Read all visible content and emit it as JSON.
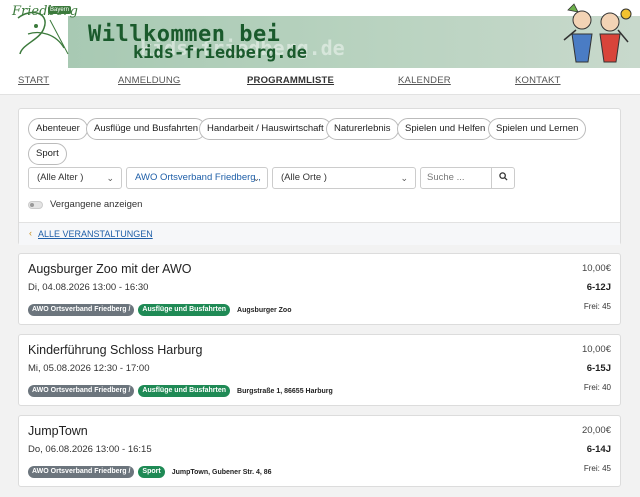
{
  "header": {
    "logo_text": "Friedberg",
    "logo_badge": "Bayern",
    "title_line1": "Willkommen bei",
    "title_line2": "kids-friedberg.de",
    "watermark": "kids-friedberg.de"
  },
  "nav": {
    "items": [
      {
        "label": "START"
      },
      {
        "label": "ANMELDUNG"
      },
      {
        "label": "PROGRAMMLISTE"
      },
      {
        "label": "KALENDER"
      },
      {
        "label": "KONTAKT"
      }
    ]
  },
  "filters": {
    "categories": [
      "Abenteuer",
      "Ausflüge und Busfahrten",
      "Handarbeit / Hauswirtschaft",
      "Naturerlebnis",
      "Spielen und Helfen",
      "Spielen und Lernen",
      "Sport"
    ],
    "age_select": "(Alle Alter )",
    "organizer_select": "AWO Ortsverband Friedberg ,",
    "location_select": "(Alle Orte )",
    "search_placeholder": "Suche ...",
    "search_icon": "search-icon",
    "past_toggle_label": "Vergangene anzeigen",
    "all_events_link": "ALLE VERANSTALTUNGEN"
  },
  "events": [
    {
      "name": "Augsburger Zoo mit der AWO",
      "date": "Di, 04.08.2026 13:00 - 16:30",
      "price": "10,00€",
      "age": "6-12J",
      "free": "Frei: 45",
      "organizer_tag": "AWO Ortsverband Friedberg /",
      "category_tag": "Ausflüge und Busfahrten",
      "location": "Augsburger Zoo"
    },
    {
      "name": "Kinderführung Schloss Harburg",
      "date": "Mi, 05.08.2026 12:30 - 17:00",
      "price": "10,00€",
      "age": "6-15J",
      "free": "Frei: 40",
      "organizer_tag": "AWO Ortsverband Friedberg /",
      "category_tag": "Ausflüge und Busfahrten",
      "location": "Burgstraße 1, 86655 Harburg"
    },
    {
      "name": "JumpTown",
      "date": "Do, 06.08.2026 13:00 - 16:15",
      "price": "20,00€",
      "age": "6-14J",
      "free": "Frei: 45",
      "organizer_tag": "AWO Ortsverband Friedberg /",
      "category_tag": "Sport",
      "location": "JumpTown, Gubener Str. 4, 86"
    }
  ],
  "colors": {
    "brand_green": "#1a5a2c",
    "banner_bg": "#b9d3c0",
    "category_tag": "#1f8a55",
    "organizer_tag": "#6c757d",
    "link_blue": "#1f5fa8"
  }
}
